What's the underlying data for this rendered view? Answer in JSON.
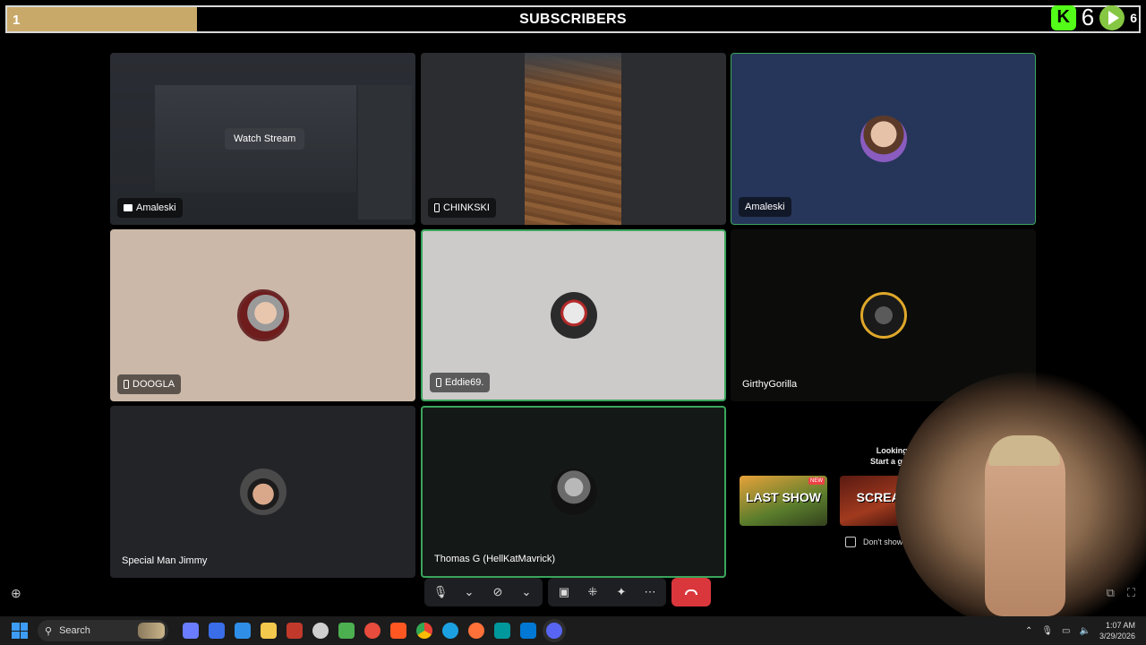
{
  "subscriber_bar": {
    "left_count": "1",
    "title": "SUBSCRIBERS",
    "kick_icon_letter": "K",
    "kick_count": "6",
    "right_count": "6",
    "progress_fraction": 0.168
  },
  "tiles": [
    {
      "name": "Amaleski",
      "watch_label": "Watch Stream",
      "type": "screen-share"
    },
    {
      "name": "CHINKSKI",
      "type": "camera-mobile"
    },
    {
      "name": "Amaleski",
      "type": "avatar"
    },
    {
      "name": "DOOGLA",
      "type": "avatar-mobile"
    },
    {
      "name": "Eddie69.",
      "type": "avatar-mobile"
    },
    {
      "name": "GirthyGorilla",
      "type": "avatar"
    },
    {
      "name": "Special Man Jimmy",
      "type": "avatar"
    },
    {
      "name": "Thomas G (HellKatMavrick)",
      "type": "avatar"
    }
  ],
  "activity": {
    "line1": "Looking for something to d",
    "line2": "Start a game or video playlist i",
    "game_a": "LAST SHOW",
    "game_a_badge": "NEW",
    "game_b": "SCREAM",
    "checkbox_label": "Don't show again"
  },
  "taskbar": {
    "search_label": "Search",
    "time": "1:07 AM",
    "date": "3/29/2026"
  },
  "colors": {
    "speaking_border": "#3ba55c",
    "end_call": "#da373c",
    "progress_fill": "#c9a96a"
  }
}
